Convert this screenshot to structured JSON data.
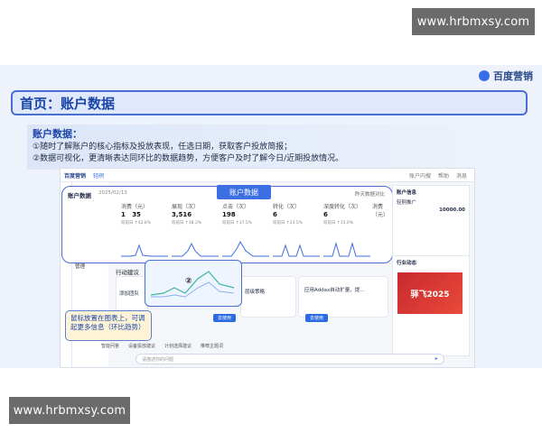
{
  "watermark": "www.hrbmxsy.com",
  "brand": {
    "name": "百度营销"
  },
  "title": "首页：账户数据",
  "note": {
    "heading": "账户数据：",
    "line1": "①随时了解账户的核心指标及投放表现，任选日期，获取客户投放简报；",
    "line2": "②数据可视化，更清晰表达同环比的数据趋势，方便客户及时了解今日/近期投放情况。"
  },
  "app": {
    "logo": "百度营销",
    "sub_logo": "轻舸",
    "top_right": [
      "账户内搜",
      "帮助",
      "消息"
    ],
    "subnav": {
      "header": "账户首页",
      "items": [
        "数据",
        "报告",
        "方案",
        "推广",
        "工具",
        "管理"
      ]
    },
    "dashboard": {
      "label": "账户数据",
      "date": "2025/02/13",
      "hint": "昨天数据对比"
    },
    "badge": "账户数据",
    "metrics": [
      {
        "name": "消费（元）",
        "value": "1",
        "value2": "35",
        "delta": "较前日 ↑42.8%"
      },
      {
        "name": "展现（次）",
        "value": "3,516",
        "delta": "较前日 ↑38.3%"
      },
      {
        "name": "点击（次）",
        "value": "198",
        "delta": "较前日 ↑37.5%"
      },
      {
        "name": "转化（次）",
        "value": "6",
        "delta": "较前日 ↑23.5%"
      },
      {
        "name": "深度转化（次）",
        "value": "6",
        "delta": "较前日 ↑15.0%"
      },
      {
        "name": "消费（元）",
        "value": "",
        "delta": ""
      }
    ],
    "action_label": "行动建议",
    "marker": "②",
    "cards": [
      {
        "title": "添加团队",
        "button": "去使用"
      },
      {
        "title": "层级策略",
        "button": "去使用"
      },
      {
        "title": "应用Addax自动扩量，提...",
        "button": "去使用"
      }
    ],
    "account_info": {
      "heading": "账户信息",
      "name": "轻舸推广",
      "balance": "10000.00"
    },
    "industry": {
      "heading": "行业动态",
      "poster": "驿飞2025"
    },
    "tooltip": "鼠标放置在图表上，可调起更多信息（环比趋势）",
    "assist": [
      "智能问答",
      "设备投放建议",
      "计划选择建议",
      "推荐主题词"
    ],
    "chat_placeholder": "请描述你的问题",
    "chat_send": "➤"
  }
}
